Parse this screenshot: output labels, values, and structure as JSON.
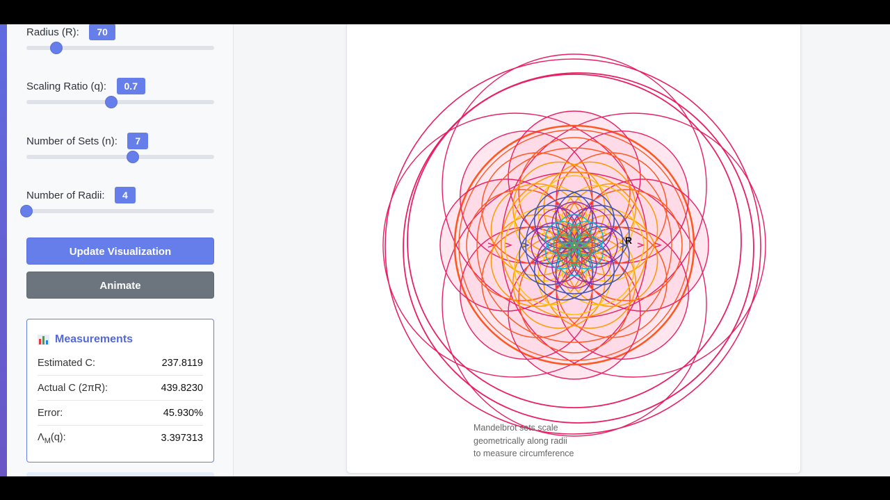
{
  "controls": [
    {
      "label": "Radius (R):",
      "value": "70",
      "fraction": 0.16
    },
    {
      "label": "Scaling Ratio (q):",
      "value": "0.7",
      "fraction": 0.45
    },
    {
      "label": "Number of Sets (n):",
      "value": "7",
      "fraction": 0.565
    },
    {
      "label": "Number of Radii:",
      "value": "4",
      "fraction": 0.0
    }
  ],
  "buttons": {
    "update_label": "Update Visualization",
    "animate_label": "Animate"
  },
  "measurements": {
    "title": "Measurements",
    "title_icon": "bar-chart-icon",
    "rows": [
      {
        "label": "Estimated C:",
        "value": "237.8119"
      },
      {
        "label": "Actual C (2πR):",
        "value": "439.8230"
      },
      {
        "label": "Error:",
        "value": "45.930%"
      },
      {
        "label": "Λ",
        "label_sub": "M",
        "label_suffix": "(q):",
        "value": "3.397313"
      }
    ]
  },
  "visualization": {
    "radius_label": "R",
    "caption": [
      "Mandelbrot sets scale",
      "geometrically along radii",
      "to measure circumference"
    ],
    "colors": [
      "#e91e63",
      "#ff5722",
      "#ff9800",
      "#ffc107",
      "#3f51b5",
      "#9c27b0",
      "#00bcd4",
      "#4caf50",
      "#f44336"
    ],
    "fill_color": "#ffd1e1"
  }
}
